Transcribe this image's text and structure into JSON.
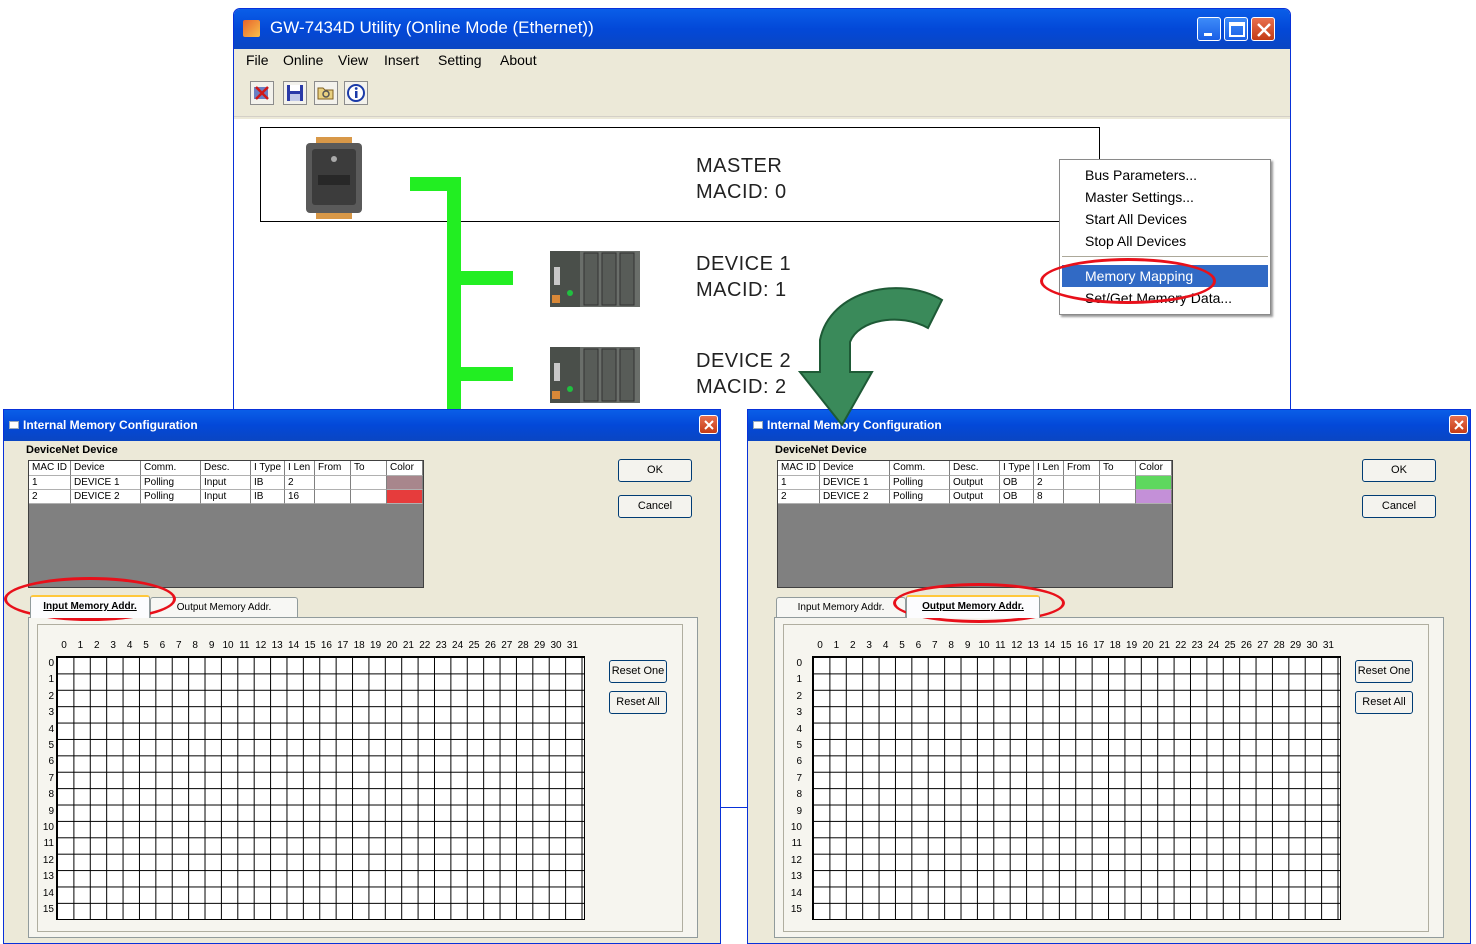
{
  "main_window": {
    "title": "GW-7434D Utility (Online Mode (Ethernet))",
    "menu": [
      "File",
      "Online",
      "View",
      "Insert",
      "Setting",
      "About"
    ],
    "toolbar_icons": [
      "disconnect-icon",
      "save-icon",
      "open-icon",
      "info-icon"
    ],
    "devices": [
      {
        "name": "MASTER",
        "macid": "MACID:  0"
      },
      {
        "name": "DEVICE 1",
        "macid": "MACID:   1"
      },
      {
        "name": "DEVICE 2",
        "macid": "MACID:   2"
      }
    ]
  },
  "context_menu": {
    "items": [
      "Bus Parameters...",
      "Master Settings...",
      "Start All Devices",
      "Stop All Devices",
      "Memory Mapping",
      "Set/Get Memory Data..."
    ],
    "selected": "Memory Mapping",
    "highlight_color": "#316ac5"
  },
  "annotation": {
    "arrow_color": "#3a8a5a",
    "ellipse_color": "#e8101a"
  },
  "dialog_left": {
    "title": "Internal Memory Configuration",
    "section": "DeviceNet Device",
    "columns": [
      "MAC ID",
      "Device",
      "Comm.",
      "Desc.",
      "I Type",
      "I Len",
      "From",
      "To",
      "Color"
    ],
    "rows": [
      {
        "mac": "1",
        "device": "DEVICE 1",
        "comm": "Polling",
        "desc": "Input",
        "type": "IB",
        "len": "2",
        "from": "",
        "to": "",
        "color": "#a8868c"
      },
      {
        "mac": "2",
        "device": "DEVICE 2",
        "comm": "Polling",
        "desc": "Input",
        "type": "IB",
        "len": "16",
        "from": "",
        "to": "",
        "color": "#e63c3c"
      }
    ],
    "ok": "OK",
    "cancel": "Cancel",
    "tabs": [
      "Input Memory Addr.",
      "Output Memory Addr."
    ],
    "active_tab": 0,
    "reset_one": "Reset One",
    "reset_all": "Reset All"
  },
  "dialog_right": {
    "title": "Internal Memory Configuration",
    "section": "DeviceNet Device",
    "columns": [
      "MAC ID",
      "Device",
      "Comm.",
      "Desc.",
      "I Type",
      "I Len",
      "From",
      "To",
      "Color"
    ],
    "rows": [
      {
        "mac": "1",
        "device": "DEVICE 1",
        "comm": "Polling",
        "desc": "Output",
        "type": "OB",
        "len": "2",
        "from": "",
        "to": "",
        "color": "#5ed85e"
      },
      {
        "mac": "2",
        "device": "DEVICE 2",
        "comm": "Polling",
        "desc": "Output",
        "type": "OB",
        "len": "8",
        "from": "",
        "to": "",
        "color": "#c490d8"
      }
    ],
    "ok": "OK",
    "cancel": "Cancel",
    "tabs": [
      "Input Memory Addr.",
      "Output Memory Addr."
    ],
    "active_tab": 1,
    "reset_one": "Reset One",
    "reset_all": "Reset All"
  },
  "grid_columns": [
    "0",
    "1",
    "2",
    "3",
    "4",
    "5",
    "6",
    "7",
    "8",
    "9",
    "10",
    "11",
    "12",
    "13",
    "14",
    "15",
    "16",
    "17",
    "18",
    "19",
    "20",
    "21",
    "22",
    "23",
    "24",
    "25",
    "26",
    "27",
    "28",
    "29",
    "30",
    "31"
  ],
  "grid_rows": [
    "0",
    "1",
    "2",
    "3",
    "4",
    "5",
    "6",
    "7",
    "8",
    "9",
    "10",
    "11",
    "12",
    "13",
    "14",
    "15"
  ]
}
